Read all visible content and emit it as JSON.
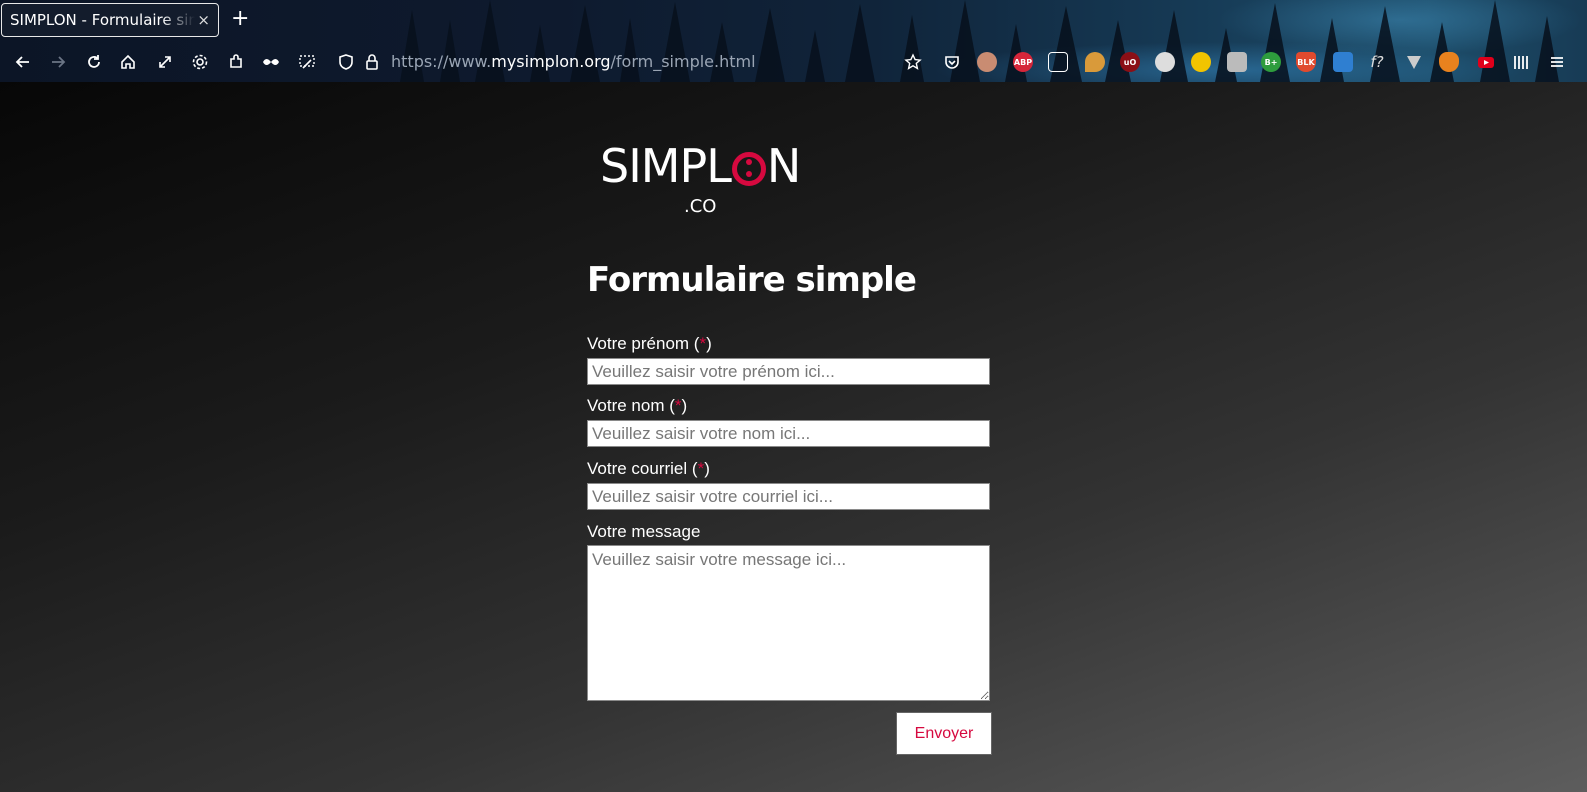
{
  "browser": {
    "tab_title": "SIMPLON - Formulaire simple",
    "new_tab_label": "+",
    "close_label": "×",
    "url_prefix": "https://www.",
    "url_host": "mysimplon.org",
    "url_path": "/form_simple.html"
  },
  "extensions": {
    "adblock": "ABP",
    "ublock": "uO",
    "bplus": "B+",
    "shield": "BLK",
    "formula": "f?"
  },
  "logo": {
    "text_before": "SIMPL",
    "text_after": "N",
    "suffix": ".CO"
  },
  "form": {
    "title": "Formulaire simple",
    "required_mark": "*",
    "firstname": {
      "label": "Votre prénom",
      "placeholder": "Veuillez saisir votre prénom ici..."
    },
    "lastname": {
      "label": "Votre nom",
      "placeholder": "Veuillez saisir votre nom ici..."
    },
    "email": {
      "label": "Votre courriel",
      "placeholder": "Veuillez saisir votre courriel ici..."
    },
    "message": {
      "label": "Votre message",
      "placeholder": "Veuillez saisir votre message ici..."
    },
    "submit_label": "Envoyer"
  },
  "colors": {
    "accent": "#d6093f",
    "page_bg_start": "#070707",
    "page_bg_end": "#5d5d5d"
  }
}
